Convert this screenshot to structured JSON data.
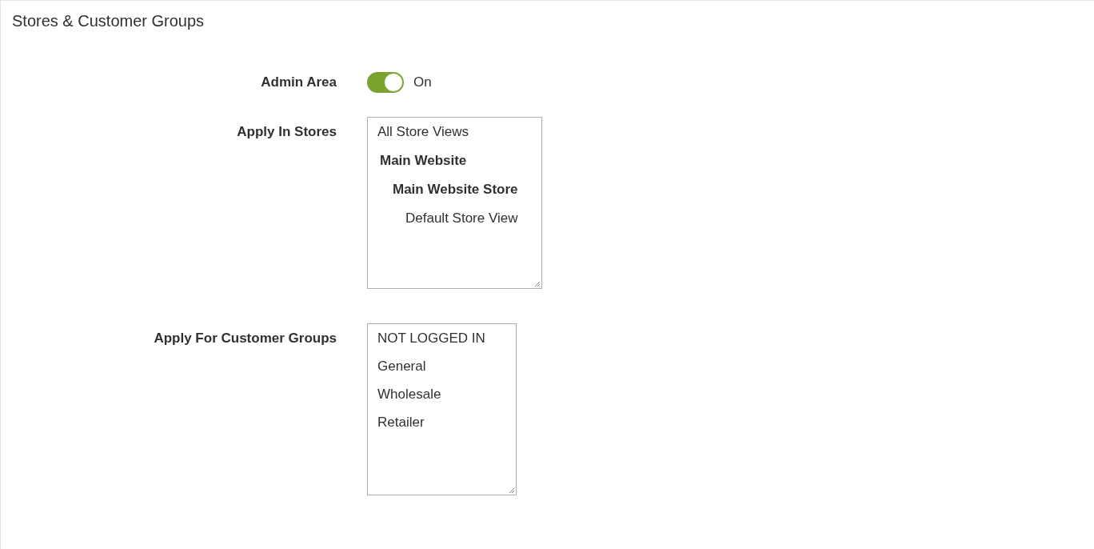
{
  "section": {
    "title": "Stores & Customer Groups"
  },
  "fields": [
    {
      "kind": "toggle",
      "label": "Admin Area",
      "on": true,
      "value_label": "On"
    },
    {
      "kind": "tree-select",
      "label": "Apply In Stores",
      "options": [
        {
          "kind": "option",
          "label": "All Store Views"
        },
        {
          "kind": "group",
          "label": "Main Website",
          "children": [
            {
              "kind": "group",
              "label": "Main Website Store",
              "children": [
                {
                  "kind": "option",
                  "label": "Default Store View"
                }
              ]
            }
          ]
        }
      ]
    },
    {
      "kind": "list-select",
      "label": "Apply For Customer Groups",
      "options": [
        {
          "kind": "option",
          "label": "NOT LOGGED IN"
        },
        {
          "kind": "option",
          "label": "General"
        },
        {
          "kind": "option",
          "label": "Wholesale"
        },
        {
          "kind": "option",
          "label": "Retailer"
        }
      ]
    }
  ]
}
